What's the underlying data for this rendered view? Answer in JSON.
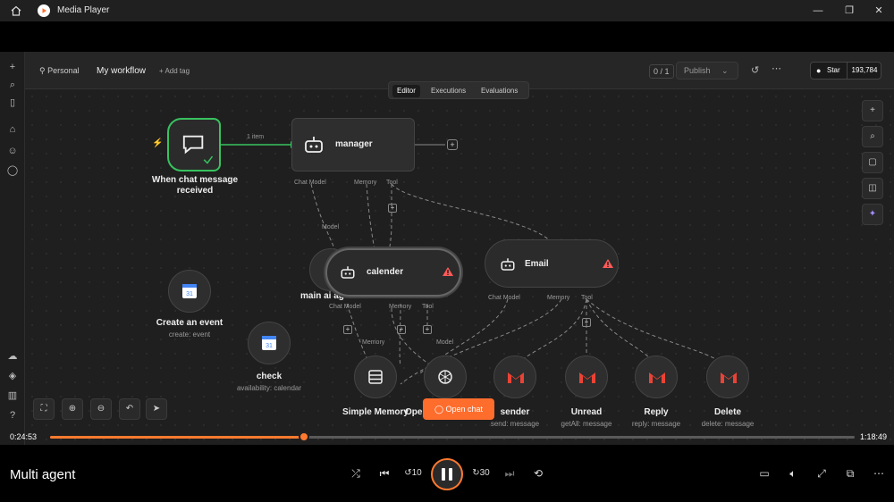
{
  "window": {
    "title": "Media Player",
    "controls": [
      "minimize",
      "maximize",
      "close"
    ]
  },
  "workflow": {
    "owner": "Personal",
    "name": "My workflow",
    "add_tag": "+ Add tag",
    "active_count": "0 / 1",
    "publish": "Publish",
    "star_label": "Star",
    "star_count": "193,784",
    "tabs": [
      "Editor",
      "Executions",
      "Evaluations"
    ],
    "active_tab": "Editor"
  },
  "canvas": {
    "trigger": {
      "label1": "When chat message",
      "label2": "received"
    },
    "edge_label": "1 item",
    "manager": {
      "label": "manager"
    },
    "manager_ports": [
      "Chat Model",
      "Memory",
      "Tool"
    ],
    "main_agent_fragment": "main ai ag",
    "main_agent_model_port": "Model",
    "calender": {
      "label": "calender"
    },
    "calender_ports": [
      "Chat Model",
      "Memory",
      "Tool"
    ],
    "email": {
      "label": "Email"
    },
    "email_ports": [
      "Chat Model",
      "Memory",
      "Tool"
    ],
    "create_event": {
      "label": "Create an event",
      "sub": "create: event"
    },
    "check": {
      "label": "check",
      "sub": "availability: calendar"
    },
    "simple_memory": {
      "label": "Simple Memory",
      "port": "Memory"
    },
    "openai": {
      "label": "Ope",
      "port": "Model"
    },
    "sender": {
      "label": "sender",
      "sub": "send: message"
    },
    "unread": {
      "label": "Unread",
      "sub": "getAll: message"
    },
    "reply": {
      "label": "Reply",
      "sub": "reply: message"
    },
    "delete": {
      "label": "Delete",
      "sub": "delete: message"
    },
    "open_chat": "Open chat"
  },
  "player": {
    "media_title": "Multi agent",
    "elapsed": "0:24:53",
    "duration": "1:18:49",
    "progress": 0.316,
    "accent": "#ff7a2f"
  },
  "colors": {
    "n8n_orange": "#ff6d2d",
    "trigger_green": "#38c25f",
    "warning_red": "#ff5a5a",
    "gmail_red": "#ea4335"
  }
}
